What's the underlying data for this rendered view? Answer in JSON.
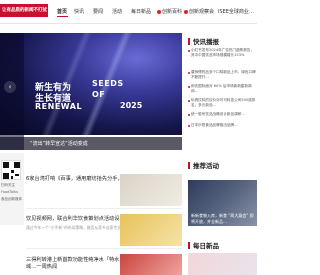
{
  "colors": {
    "brand": "#c8102e",
    "nav_bg": "#ffffff",
    "hero_dark": "#0b0c2a"
  },
  "logo": {
    "text": "让有品质的新闻不打扰"
  },
  "nav": [
    {
      "label": "首页"
    },
    {
      "label": "快讯"
    },
    {
      "label": "要闻"
    },
    {
      "label": "活动"
    },
    {
      "label": "每日新品"
    },
    {
      "label": "创新百科"
    },
    {
      "label": "创新观察会"
    },
    {
      "label": "iSEE全球商业…"
    }
  ],
  "hero": {
    "line1_cn": "新生有为",
    "line1_en": "SEEDS",
    "line2_cn": "生长有道",
    "line2_en": "OF",
    "line3_en": "RENEWAL",
    "year": "2025",
    "caption": "“流出”转早宣达”活动变成"
  },
  "qr": {
    "label1": "扫码关注",
    "label2": "FoodTalks",
    "label3": "食品创新媒体"
  },
  "news": [
    {
      "title": "6家台湾打响《百事，通用磨坊拾先分手，烈头到底拒打了什么？",
      "sub": "",
      "meta": ""
    },
    {
      "title": "饮见视频网，联合利华饮食策划点活动设出“专业”带香",
      "sub": "通过今年一个“小手新”的布局策略，能否从家乡自家专业突出产品“拼”与“吃”，此可称为…",
      "meta": ""
    },
    {
      "title": "三得利转港上新首款功能性纯净水「特水」，康师傅宣告将手时装领域…一周热闻",
      "sub": "",
      "meta": ""
    }
  ],
  "right": {
    "flash_title": "快讯播报",
    "flash_items": [
      "小红书发布2024年广告热门趋势报告，其中中国饮品市场规模增长153%",
      "康师傅药品多个口味新品上市，绿色口碑不断提升…",
      "和氏国际面对 60% 后市场新新星新闻网…",
      "玩具饮料的议价对可可科技公司500强排名，多元新品…",
      "统一股份饮品战略设计新品调研…",
      "日本乐短食品品牌推出品牌…"
    ],
    "recommend_title": "推荐活动",
    "recommend_text": "新新食物入库，新食 “两大展会” 即将开放，并全新品…",
    "daily_title": "每日新品"
  }
}
